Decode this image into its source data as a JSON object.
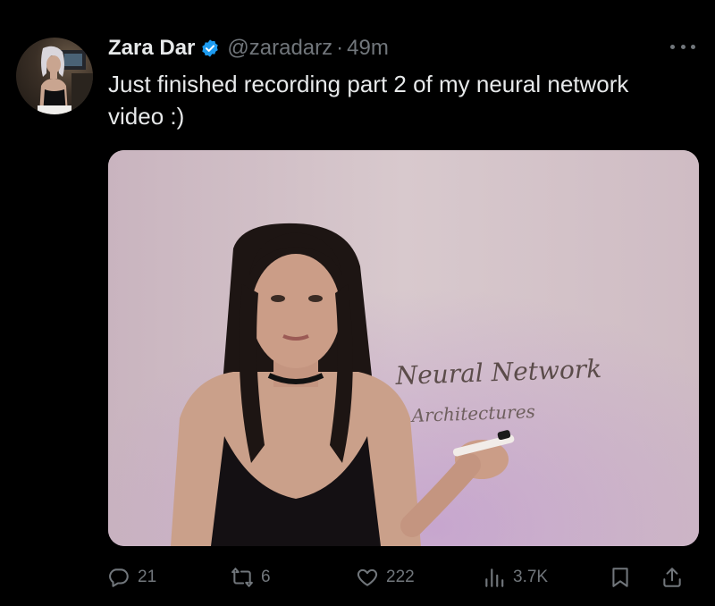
{
  "author": {
    "display_name": "Zara Dar",
    "handle": "@zaradarz",
    "separator": "·",
    "time": "49m"
  },
  "tweet": {
    "text": "Just finished recording part 2 of my neural network video :)"
  },
  "media": {
    "whiteboard_line1": "Neural Network",
    "whiteboard_line2": "Architectures"
  },
  "actions": {
    "replies": "21",
    "retweets": "6",
    "likes": "222",
    "views": "3.7K"
  },
  "colors": {
    "background": "#000000",
    "primary_text": "#e7e9ea",
    "secondary_text": "#71767b",
    "verified_blue": "#1d9bf0"
  },
  "icons": [
    "verified-badge-icon",
    "more-icon",
    "reply-icon",
    "retweet-icon",
    "like-icon",
    "views-icon",
    "bookmark-icon",
    "share-icon"
  ]
}
